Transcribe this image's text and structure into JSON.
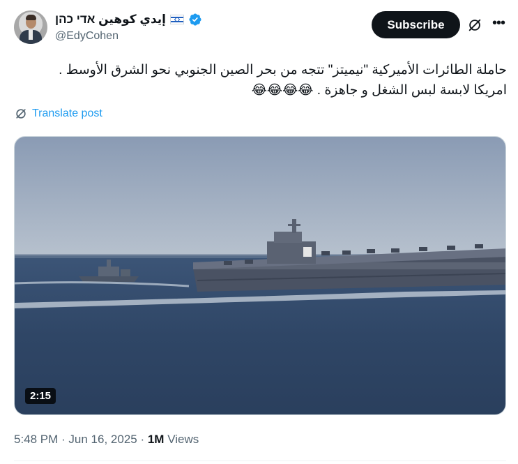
{
  "author": {
    "display_name": "إيدي كوهين אדי כהן",
    "handle": "@EdyCohen",
    "flag": "israel-flag-icon",
    "verified": true
  },
  "actions": {
    "subscribe_label": "Subscribe"
  },
  "post": {
    "lines": [
      "حاملة الطائرات الأميركية \"نيميتز\" تتجه من بحر الصين الجنوبي نحو الشرق الأوسط .",
      "امريكا لابسة لبس الشغل و جاهزة . 😂😂😂😂"
    ],
    "translate_label": "Translate post"
  },
  "video": {
    "duration": "2:15"
  },
  "meta": {
    "time": "5:48 PM",
    "separator1": " · ",
    "date": "Jun 16, 2025",
    "separator2": " · ",
    "views_count": "1M",
    "views_label": " Views"
  },
  "colors": {
    "link": "#1d9bf0",
    "muted": "#536471",
    "text": "#0f1419",
    "verified": "#1d9bf0"
  }
}
